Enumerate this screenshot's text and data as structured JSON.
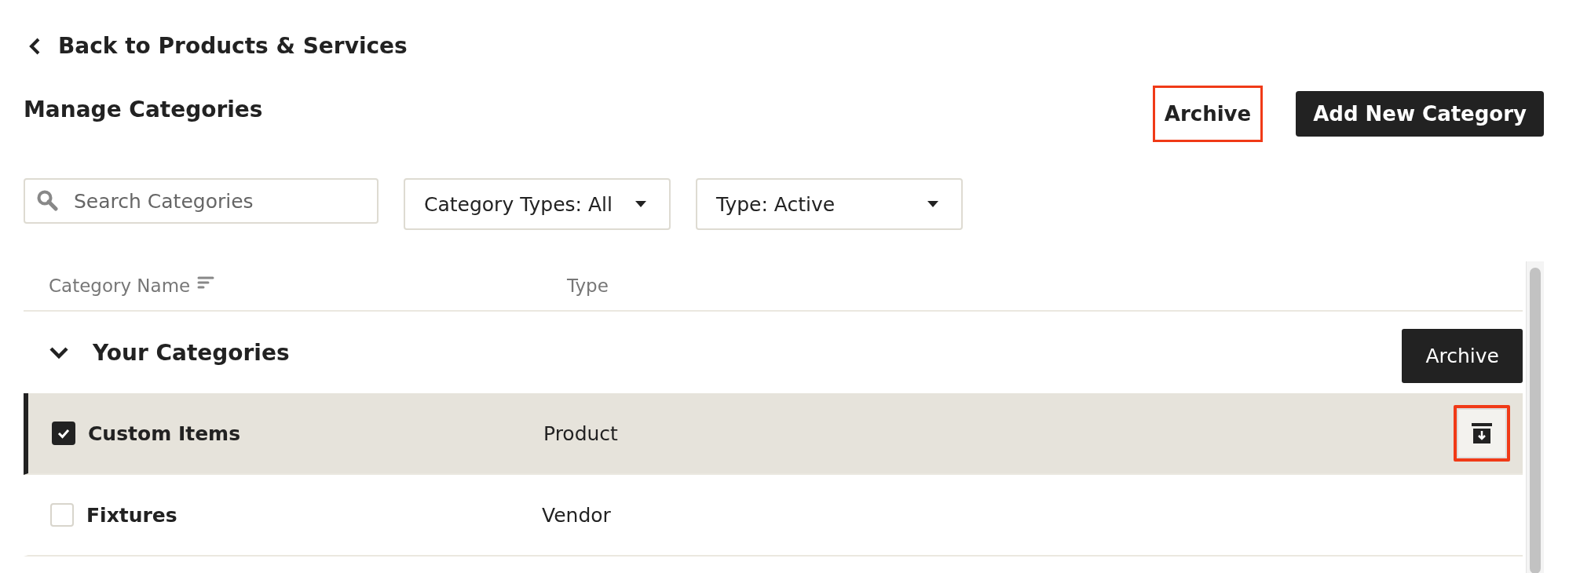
{
  "back_link": {
    "label": "Back to Products & Services"
  },
  "title": "Manage Categories",
  "actions": [
    {
      "kind": "plain",
      "label": "Archive",
      "highlighted": true
    },
    {
      "kind": "primary",
      "label": "Add New Category",
      "highlighted": false
    }
  ],
  "search": {
    "placeholder": "Search Categories"
  },
  "filters": [
    {
      "label": "Category Types: All"
    },
    {
      "label": "Type: Active"
    }
  ],
  "table": {
    "columns": [
      {
        "label": "Category Name",
        "sortable": true
      },
      {
        "label": "Type",
        "sortable": false
      }
    ],
    "groups": [
      {
        "label": "Your Categories",
        "expanded": true,
        "rows": [
          {
            "name": "Custom Items",
            "type": "Product",
            "checked": true,
            "selected": true,
            "tooltip": "Archive",
            "archive_highlighted": true
          },
          {
            "name": "Fixtures",
            "type": "Vendor",
            "checked": false,
            "selected": false
          }
        ]
      }
    ]
  }
}
